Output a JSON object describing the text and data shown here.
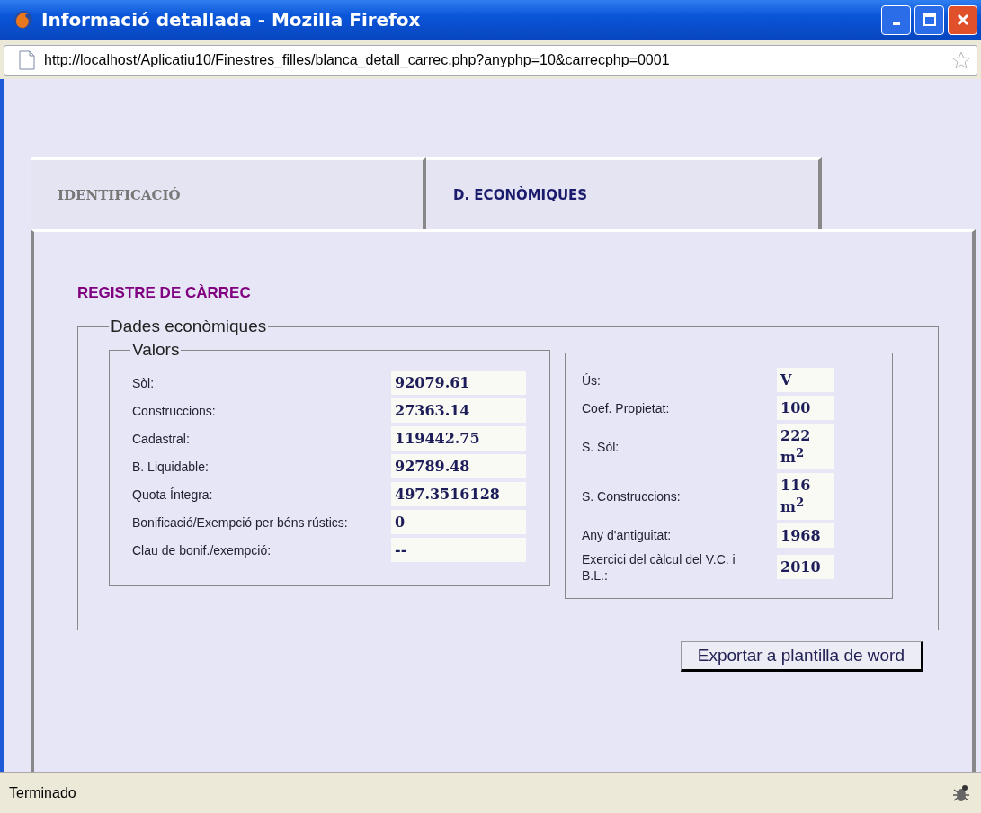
{
  "window": {
    "title": "Informació detallada - Mozilla Firefox"
  },
  "address_bar": {
    "url": "http://localhost/Aplicatiu10/Finestres_filles/blanca_detall_carrec.php?anyphp=10&carrecphp=0001"
  },
  "tabs": [
    {
      "label": "IDENTIFICACIÓ",
      "selected": false
    },
    {
      "label": "D. ECONÒMIQUES",
      "selected": true
    }
  ],
  "heading": "REGISTRE DE CÀRREC",
  "fieldset": {
    "legend": "Dades econòmiques",
    "valors": {
      "legend": "Valors",
      "rows": [
        {
          "label": "Sòl:",
          "value": "92079.61"
        },
        {
          "label": "Construccions:",
          "value": "27363.14"
        },
        {
          "label": "Cadastral:",
          "value": "119442.75"
        },
        {
          "label": "B. Liquidable:",
          "value": "92789.48"
        },
        {
          "label": "Quota Íntegra:",
          "value": "497.3516128"
        },
        {
          "label": "Bonificació/Exempció per béns rústics:",
          "value": "0"
        },
        {
          "label": "Clau de bonif./exempció:",
          "value": "--"
        }
      ]
    },
    "details": {
      "rows": [
        {
          "label": "Ús:",
          "value": "V"
        },
        {
          "label": "Coef. Propietat:",
          "value": "100"
        },
        {
          "label": "S. Sòl:",
          "value": "222 m$^{2}$"
        },
        {
          "label": "S. Construccions:",
          "value": "116 m$^{2}$"
        },
        {
          "label": "Any d'antiguitat:",
          "value": "1968"
        },
        {
          "label": "Exercici del càlcul del V.C. i B.L.:",
          "value": "2010"
        }
      ]
    }
  },
  "export_button": "Exportar a plantilla de word",
  "status_bar": {
    "text": "Terminado"
  }
}
